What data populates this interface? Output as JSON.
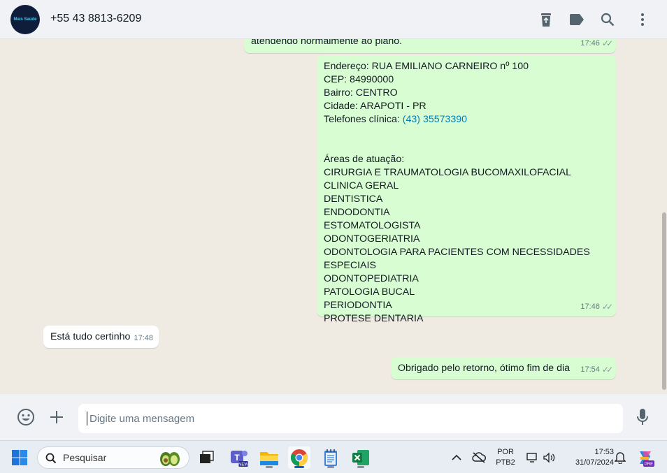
{
  "header": {
    "contact_name": "+55 43 8813-6209",
    "avatar_text": "Mais Saúde",
    "icons": [
      "archive-icon",
      "label-icon",
      "search-icon",
      "menu-icon"
    ]
  },
  "messages": {
    "msg1_text": "atendendo normalmente ao plano.",
    "msg1_time": "17:46",
    "msg2_lines": [
      "Endereço: RUA EMILIANO CARNEIRO nº 100",
      "CEP: 84990000",
      "Bairro: CENTRO",
      "Cidade: ARAPOTI - PR"
    ],
    "msg2_phone_label": "Telefones clínica: ",
    "msg2_phone": "(43) 35573390",
    "msg2_areas_title": "Áreas de atuação:",
    "msg2_areas": [
      "CIRURGIA E TRAUMATOLOGIA BUCOMAXILOFACIAL",
      "CLINICA GERAL",
      "DENTISTICA",
      "ENDODONTIA",
      "ESTOMATOLOGISTA",
      "ODONTOGERIATRIA",
      "ODONTOLOGIA PARA PACIENTES COM NECESSIDADES ESPECIAIS",
      "ODONTOPEDIATRIA",
      "PATOLOGIA BUCAL",
      "PERIODONTIA",
      "PROTESE DENTARIA"
    ],
    "msg2_time": "17:46",
    "msg3_text": "Está tudo certinho",
    "msg3_time": "17:48",
    "msg4_text": "Obrigado pelo retorno, ótimo fim de dia",
    "msg4_time": "17:54"
  },
  "composer": {
    "placeholder": "Digite uma mensagem",
    "icons": [
      "emoji-icon",
      "plus-icon",
      "microphone-icon"
    ]
  },
  "taskbar": {
    "search_placeholder": "Pesquisar",
    "lang_top": "POR",
    "lang_bottom": "PTB2",
    "time": "17:53",
    "date": "31/07/2024",
    "copilot_badge": "PRE",
    "teams_badge": "NEW"
  },
  "colors": {
    "outgoing_bubble": "#d9fdd3",
    "incoming_bubble": "#ffffff",
    "chat_background": "#efeae2",
    "link": "#027eb5"
  }
}
